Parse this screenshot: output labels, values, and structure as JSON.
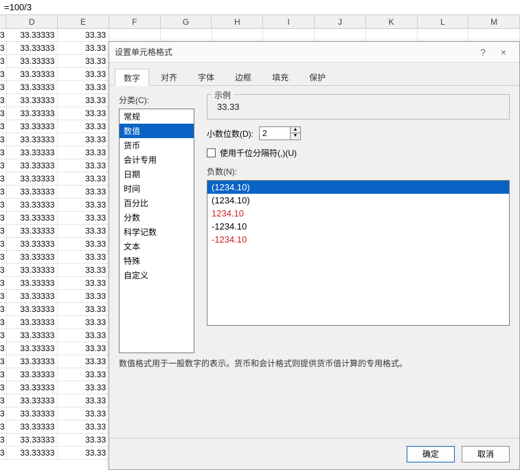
{
  "formula_bar": "=100/3",
  "columns": [
    "D",
    "E",
    "F",
    "G",
    "H",
    "I",
    "J",
    "K",
    "L",
    "M"
  ],
  "cell_d": "33.33333",
  "cell_e": "33.33",
  "row_count": 33,
  "dialog": {
    "title": "设置单元格格式",
    "help": "?",
    "close": "×",
    "tabs": {
      "number": "数字",
      "align": "对齐",
      "font": "字体",
      "border": "边框",
      "fill": "填充",
      "protect": "保护"
    },
    "category_label": "分类(C):",
    "categories": [
      "常规",
      "数值",
      "货币",
      "会计专用",
      "日期",
      "时间",
      "百分比",
      "分数",
      "科学记数",
      "文本",
      "特殊",
      "自定义"
    ],
    "selected_category": "数值",
    "sample_label": "示例",
    "sample_value": "33.33",
    "decimal_label": "小数位数(D):",
    "decimal_value": "2",
    "thousands_label": "使用千位分隔符(,)(U)",
    "negative_label": "负数(N):",
    "negatives": [
      {
        "text": "(1234.10)",
        "red": true,
        "selected": true
      },
      {
        "text": "(1234.10)",
        "red": false,
        "selected": false
      },
      {
        "text": "1234.10",
        "red": true,
        "selected": false
      },
      {
        "text": "-1234.10",
        "red": false,
        "selected": false
      },
      {
        "text": "-1234.10",
        "red": true,
        "selected": false
      }
    ],
    "desc": "数值格式用于一般数字的表示。货币和会计格式则提供货币值计算的专用格式。",
    "ok": "确定",
    "cancel": "取消"
  }
}
